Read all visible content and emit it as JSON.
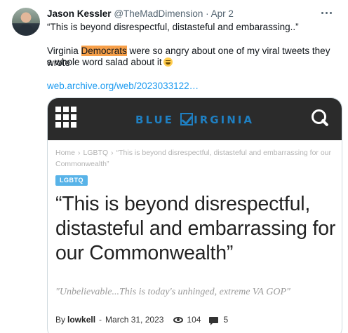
{
  "tweet": {
    "author_name": "Jason Kessler",
    "handle": "@TheMadDimension",
    "separator": "·",
    "date": "Apr 2",
    "quote_line": "“This is beyond disrespectful, distasteful and embarassing..”",
    "body_before": "Virginia ",
    "body_highlight": "Democrats",
    "body_after": " were so angry about one of my viral tweets they wrote",
    "body_line2": "a whole word salad about it",
    "emoji": "laughing-face",
    "link": "web.archive.org/web/2023033122…"
  },
  "card": {
    "site_logo_left": "BLUE",
    "site_logo_right": "IRGINIA",
    "breadcrumb": {
      "home": "Home",
      "sep": "›",
      "category": "LGBTQ",
      "current": "“This is beyond disrespectful, distasteful and embarrassing for our Commonwealth”"
    },
    "tag": "LGBTQ",
    "headline": "“This is beyond disrespectful, distasteful and embarrassing for our Commonwealth”",
    "subhead": "\"Unbelievable...This is today's unhinged, extreme VA GOP\"",
    "by_label": "By",
    "author": "lowkell",
    "meta_sep": "-",
    "date": "March 31, 2023",
    "views": "104",
    "comments": "5"
  },
  "colors": {
    "link": "#1d9bf0",
    "highlight": "#f7a04a",
    "site_header": "#2b2b2b",
    "logo_blue": "#1f7fc1",
    "tag_bg": "#58b3e8"
  }
}
